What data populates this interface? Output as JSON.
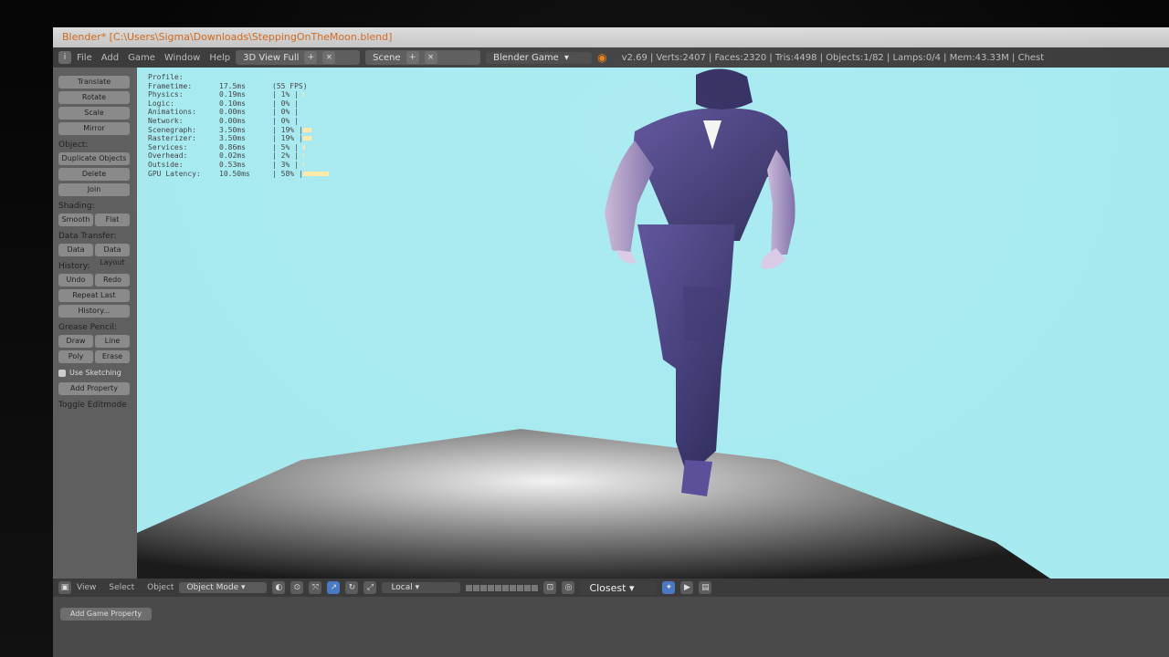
{
  "window": {
    "title": "Blender* [C:\\Users\\Sigma\\Downloads\\SteppingOnTheMoon.blend]"
  },
  "header": {
    "menus": [
      "File",
      "Add",
      "Game",
      "Window",
      "Help"
    ],
    "layout": "3D View Full",
    "scene": "Scene",
    "engine": "Blender Game",
    "stats": "v2.69 | Verts:2407 | Faces:2320 | Tris:4498 | Objects:1/82 | Lamps:0/4 | Mem:43.33M | Chest"
  },
  "toolshelf": {
    "items": [
      {
        "type": "button",
        "label": "Translate"
      },
      {
        "type": "button",
        "label": "Rotate"
      },
      {
        "type": "button",
        "label": "Scale"
      },
      {
        "type": "button",
        "label": "Mirror"
      },
      {
        "type": "section",
        "label": "Object:"
      },
      {
        "type": "button",
        "label": "Duplicate Objects"
      },
      {
        "type": "button",
        "label": "Delete"
      },
      {
        "type": "button",
        "label": "Join"
      },
      {
        "type": "section",
        "label": "Shading:"
      },
      {
        "type": "row",
        "labels": [
          "Smooth",
          "Flat"
        ]
      },
      {
        "type": "section",
        "label": "Data Transfer:"
      },
      {
        "type": "row",
        "labels": [
          "Data",
          "Data Layout"
        ]
      },
      {
        "type": "section",
        "label": "History:"
      },
      {
        "type": "row",
        "labels": [
          "Undo",
          "Redo"
        ]
      },
      {
        "type": "button",
        "label": "Repeat Last"
      },
      {
        "type": "button",
        "label": "History..."
      },
      {
        "type": "section",
        "label": "Grease Pencil:"
      },
      {
        "type": "row",
        "labels": [
          "Draw",
          "Line"
        ]
      },
      {
        "type": "row",
        "labels": [
          "Poly",
          "Erase"
        ]
      },
      {
        "type": "check",
        "label": "Use Sketching"
      },
      {
        "type": "button",
        "label": "Add Property"
      },
      {
        "type": "section",
        "label": "Toggle Editmode"
      }
    ]
  },
  "profile": {
    "title": "Profile:",
    "rows": [
      {
        "name": "Frametime:",
        "ms": "17.5ms",
        "pct": "(55 FPS)",
        "bar": 0
      },
      {
        "name": "Physics:",
        "ms": "0.19ms",
        "pct": "| 1% |",
        "bar": 0.02
      },
      {
        "name": "Logic:",
        "ms": "0.10ms",
        "pct": "| 0% |",
        "bar": 0.0
      },
      {
        "name": "Animations:",
        "ms": "0.00ms",
        "pct": "| 0% |",
        "bar": 0.0
      },
      {
        "name": "Network:",
        "ms": "0.00ms",
        "pct": "| 0% |",
        "bar": 0.0
      },
      {
        "name": "Scenegraph:",
        "ms": "3.50ms",
        "pct": "| 19% |",
        "bar": 0.19
      },
      {
        "name": "Rasterizer:",
        "ms": "3.50ms",
        "pct": "| 19% |",
        "bar": 0.19
      },
      {
        "name": "Services:",
        "ms": "0.86ms",
        "pct": "| 5% |",
        "bar": 0.05
      },
      {
        "name": "Overhead:",
        "ms": "0.02ms",
        "pct": "| 2% |",
        "bar": 0.02
      },
      {
        "name": "Outside:",
        "ms": "0.53ms",
        "pct": "| 3% |",
        "bar": 0.03
      },
      {
        "name": "GPU Latency:",
        "ms": "10.50ms",
        "pct": "| 58% |",
        "bar": 0.58
      }
    ]
  },
  "footer": {
    "menus": [
      "View",
      "Select",
      "Object"
    ],
    "mode": "Object Mode",
    "orientation": "Local",
    "snap": "Closest"
  },
  "logic": {
    "add_button": "Add Game Property"
  }
}
